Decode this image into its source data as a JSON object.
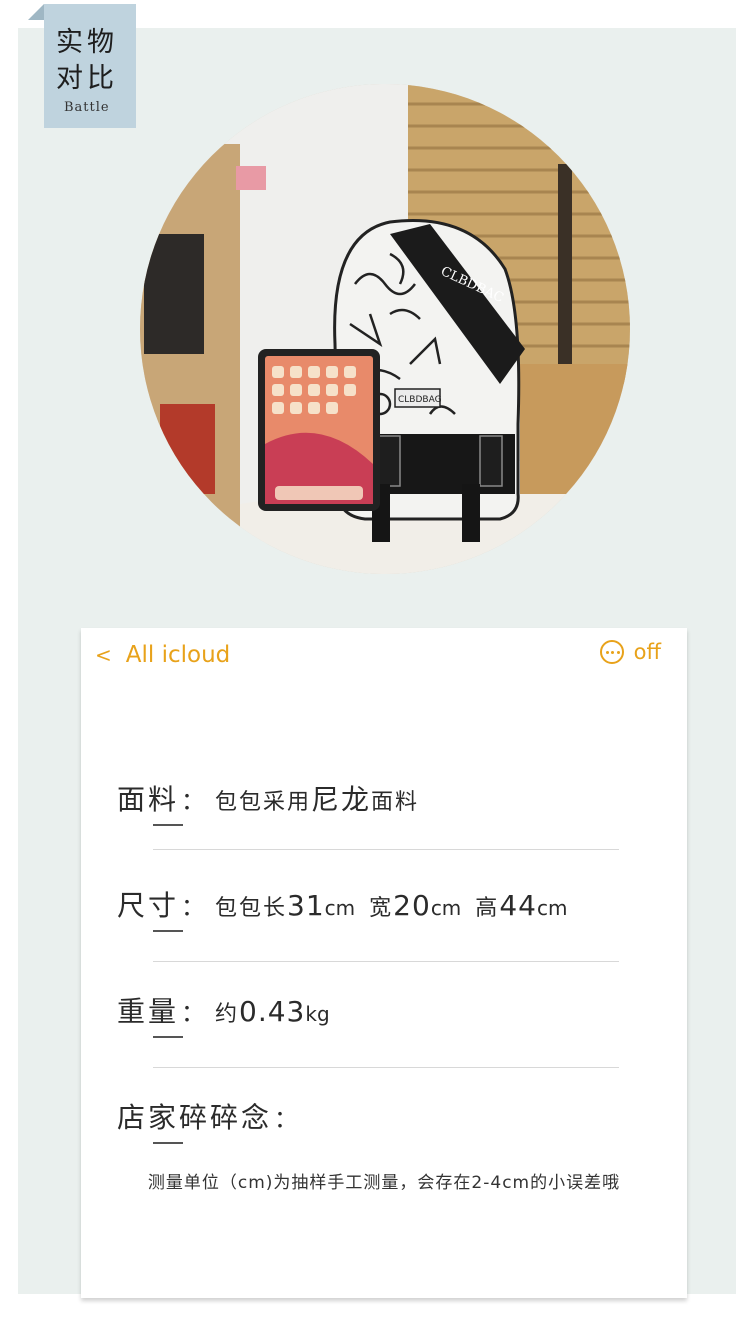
{
  "tag": {
    "title_line1": "实物",
    "title_line2": "对比",
    "subtitle": "Battle"
  },
  "photo": {
    "backpack_brand": "CLBDBAC",
    "patch_brand": "CLBDBAG"
  },
  "card": {
    "nav": {
      "back_chevron": "<",
      "back_label": "All icloud",
      "more_icon": "more-icon",
      "right_label": "off"
    },
    "material": {
      "label": "面料",
      "sep": "：",
      "prefix": "包包采用",
      "highlight": "尼龙",
      "suffix": "面料"
    },
    "size": {
      "label": "尺寸",
      "sep": "：",
      "prefix": "包包长",
      "length": "31",
      "length_unit": "cm",
      "width_label": "宽",
      "width": "20",
      "width_unit": "cm",
      "height_label": "高",
      "height": "44",
      "height_unit": "cm"
    },
    "weight": {
      "label": "重量",
      "sep": "：",
      "prefix": "约",
      "value": "0.43",
      "unit": "kg"
    },
    "notes": {
      "label": "店家碎碎念",
      "sep": "：",
      "text": "测量单位（cm)为抽样手工测量，会存在2-4cm的小误差哦"
    }
  },
  "colors": {
    "accent": "#e8a21a",
    "panel": "#eaf0ee",
    "tag": "#bfd3de"
  }
}
